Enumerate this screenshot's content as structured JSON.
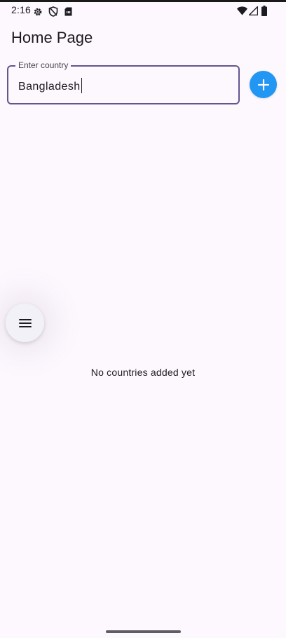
{
  "status_bar": {
    "time": "2:16",
    "left_icons": [
      "gear-icon",
      "shield-off-icon",
      "sim-card-icon"
    ],
    "right_icons": [
      "wifi-icon",
      "cell-signal-icon",
      "battery-icon"
    ]
  },
  "app_bar": {
    "title": "Home Page"
  },
  "country_input": {
    "label": "Enter country",
    "value": "Bangladesh",
    "border_color": "#65558F"
  },
  "add_button": {
    "icon": "plus-icon",
    "color": "#2196F3"
  },
  "menu_bubble": {
    "icon": "menu-icon"
  },
  "empty_state": {
    "message": "No countries added yet"
  },
  "colors": {
    "background": "#FDF7FE",
    "text": "#1C1B1F"
  }
}
